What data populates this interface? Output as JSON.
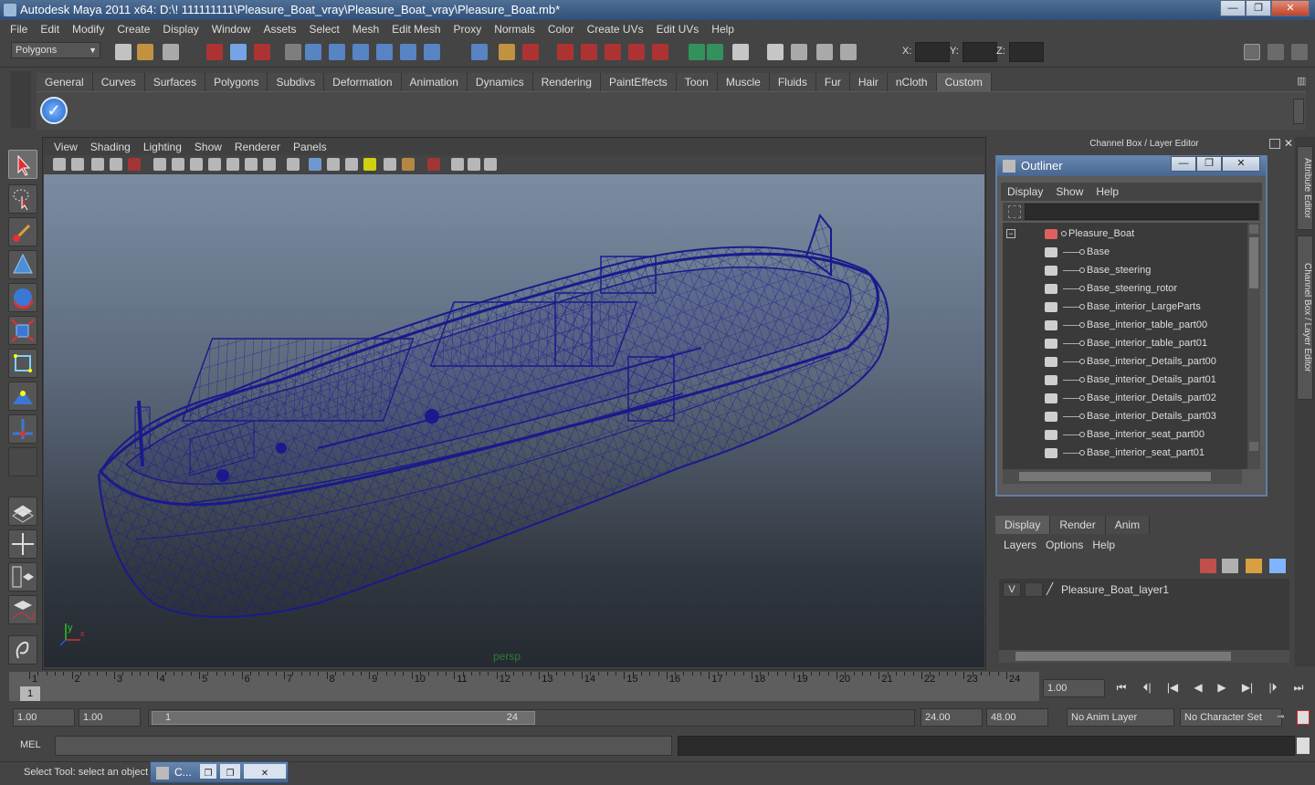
{
  "window": {
    "title": "Autodesk Maya 2011 x64: D:\\! 111111111\\Pleasure_Boat_vray\\Pleasure_Boat_vray\\Pleasure_Boat.mb*",
    "minimize": "—",
    "maximize": "❐",
    "close": "✕"
  },
  "menubar": [
    "File",
    "Edit",
    "Modify",
    "Create",
    "Display",
    "Window",
    "Assets",
    "Select",
    "Mesh",
    "Edit Mesh",
    "Proxy",
    "Normals",
    "Color",
    "Create UVs",
    "Edit UVs",
    "Help"
  ],
  "statusline": {
    "mode": "Polygons",
    "x_label": "X:",
    "y_label": "Y:",
    "z_label": "Z:"
  },
  "shelf": {
    "tabs": [
      "General",
      "Curves",
      "Surfaces",
      "Polygons",
      "Subdivs",
      "Deformation",
      "Animation",
      "Dynamics",
      "Rendering",
      "PaintEffects",
      "Toon",
      "Muscle",
      "Fluids",
      "Fur",
      "Hair",
      "nCloth",
      "Custom"
    ],
    "active_tab": "Custom"
  },
  "viewport": {
    "menus": [
      "View",
      "Shading",
      "Lighting",
      "Show",
      "Renderer",
      "Panels"
    ],
    "camera_label": "persp",
    "axis_y": "y",
    "axis_x": "x",
    "wire_color": "#1a1a8c",
    "bg_top": "#7b8ca2",
    "bg_bottom": "#252a31"
  },
  "right_panel": {
    "header": "Channel Box / Layer Editor",
    "side_tabs": [
      "Attribute Editor",
      "Channel Box / Layer Editor"
    ]
  },
  "outliner": {
    "title": "Outliner",
    "menus": [
      "Display",
      "Show",
      "Help"
    ],
    "root": "Pleasure_Boat",
    "items": [
      "Base",
      "Base_steering",
      "Base_steering_rotor",
      "Base_interior_LargeParts",
      "Base_interior_table_part00",
      "Base_interior_table_part01",
      "Base_interior_Details_part00",
      "Base_interior_Details_part01",
      "Base_interior_Details_part02",
      "Base_interior_Details_part03",
      "Base_interior_seat_part00",
      "Base_interior_seat_part01"
    ],
    "collapse_glyph": "−"
  },
  "layer_editor": {
    "tabs": [
      "Display",
      "Render",
      "Anim"
    ],
    "active_tab": "Display",
    "menus": [
      "Layers",
      "Options",
      "Help"
    ],
    "layer": {
      "visible": "V",
      "name": "Pleasure_Boat_layer1"
    }
  },
  "timeline": {
    "ticks": [
      "1",
      "2",
      "3",
      "4",
      "5",
      "6",
      "7",
      "8",
      "9",
      "10",
      "11",
      "12",
      "13",
      "14",
      "15",
      "16",
      "17",
      "18",
      "19",
      "20",
      "21",
      "22",
      "23",
      "24"
    ],
    "current_marker": "1",
    "current_frame": "1.00",
    "playback_glyphs": [
      "⏮",
      "⏴|",
      "|◀",
      "◀",
      "▶",
      "▶|",
      "|⏵",
      "⏭"
    ]
  },
  "range": {
    "start": "1.00",
    "start2": "1.00",
    "handle_start": "1",
    "handle_end": "24",
    "end": "24.00",
    "end2": "48.00",
    "anim_layer": "No Anim Layer",
    "character_set": "No Character Set"
  },
  "commandline": {
    "label": "MEL",
    "help": "Select Tool: select an object",
    "min_window": "C..."
  }
}
